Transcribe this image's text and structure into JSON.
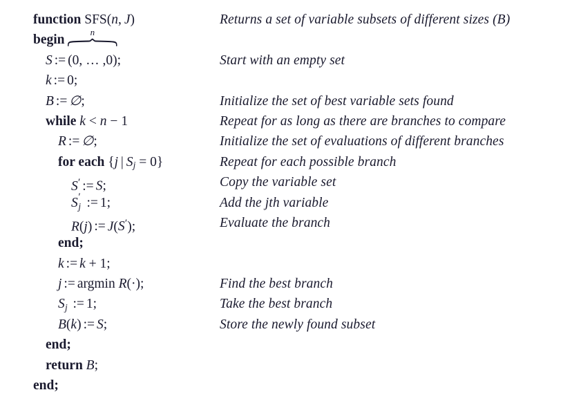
{
  "document": {
    "type": "algorithm-pseudocode",
    "title": "function SFS(n, J)",
    "background_color": "#ffffff",
    "text_color": "#1a1a2e"
  },
  "lines": [
    {
      "id": "line-function",
      "indent": 0,
      "code_plain": "function SFS(n, J)",
      "comment": "Returns a set of variable subsets of different sizes (B)"
    },
    {
      "id": "line-begin",
      "indent": 0,
      "code_plain": "begin",
      "comment": ""
    },
    {
      "id": "line-init-s",
      "indent": 1,
      "code_plain": "S := (0, ... , 0);",
      "overbrace_label": "n",
      "comment": "Start with an empty set"
    },
    {
      "id": "line-init-k",
      "indent": 1,
      "code_plain": "k := 0;",
      "comment": ""
    },
    {
      "id": "line-init-b",
      "indent": 1,
      "code_plain": "B := ∅;",
      "comment": "Initialize the set of best variable sets found"
    },
    {
      "id": "line-while",
      "indent": 1,
      "code_plain": "while k < n − 1",
      "comment": "Repeat for as long as there are branches to compare"
    },
    {
      "id": "line-init-r",
      "indent": 2,
      "code_plain": "R := ∅;",
      "comment": "Initialize the set of evaluations of different branches"
    },
    {
      "id": "line-foreach",
      "indent": 2,
      "code_plain": "for each {j | S_j = 0}",
      "comment": "Repeat for each possible branch"
    },
    {
      "id": "line-copy-s",
      "indent": 3,
      "code_plain": "S' := S;",
      "comment": "Copy the variable set"
    },
    {
      "id": "line-set-sj",
      "indent": 3,
      "code_plain": "S'_j := 1;",
      "comment": "Add the jth variable"
    },
    {
      "id": "line-eval",
      "indent": 3,
      "code_plain": "R(j) := J(S');",
      "comment": "Evaluate the branch"
    },
    {
      "id": "line-end-foreach",
      "indent": 2,
      "code_plain": "end;",
      "comment": ""
    },
    {
      "id": "line-incr-k",
      "indent": 2,
      "code_plain": "k := k + 1;",
      "comment": ""
    },
    {
      "id": "line-argmin",
      "indent": 2,
      "code_plain": "j := argmin R(·);",
      "comment": "Find the best branch"
    },
    {
      "id": "line-take-branch",
      "indent": 2,
      "code_plain": "S_j := 1;",
      "comment": "Take the best branch"
    },
    {
      "id": "line-store",
      "indent": 2,
      "code_plain": "B(k) := S;",
      "comment": "Store the newly found subset"
    },
    {
      "id": "line-end-while",
      "indent": 1,
      "code_plain": "end;",
      "comment": ""
    },
    {
      "id": "line-return",
      "indent": 1,
      "code_plain": "return B;",
      "comment": ""
    },
    {
      "id": "line-end-function",
      "indent": 0,
      "code_plain": "end;",
      "comment": ""
    }
  ],
  "tokens": {
    "kw_function": "function",
    "kw_begin": "begin",
    "kw_end": "end;",
    "kw_while": "while",
    "kw_foreach": "for each",
    "kw_return": "return",
    "rm_argmin": "argmin",
    "name_sfs": "SFS",
    "var_S": "S",
    "var_B": "B",
    "var_R": "R",
    "var_J": "J",
    "var_k": "k",
    "var_n": "n",
    "var_j": "j",
    "assign": ":=",
    "semicolon": ";",
    "emptyset": "∅",
    "lparen": "(",
    "rparen": ")",
    "comma": ",",
    "ellipsis": ", … ,",
    "zero": "0",
    "one": "1",
    "lt": "<",
    "minus": "−",
    "plus": "+",
    "eq": "=",
    "lbrace": "{",
    "rbrace": "}",
    "mid": "|",
    "cdot": "·",
    "prime": "′",
    "overbrace_n": "n"
  },
  "comments": {
    "c_function": "Returns a set of variable subsets of different sizes (B)",
    "c_init_s": "Start with an empty set",
    "c_init_b": "Initialize the set of best variable sets found",
    "c_while": "Repeat for as long as there are branches to compare",
    "c_init_r": "Initialize the set of evaluations of different branches",
    "c_foreach": "Repeat for each possible branch",
    "c_copy_s": "Copy the variable set",
    "c_set_sj": "Add the jth variable",
    "c_eval": "Evaluate the branch",
    "c_argmin": "Find the best branch",
    "c_take_branch": "Take the best branch",
    "c_store": "Store the newly found subset"
  }
}
